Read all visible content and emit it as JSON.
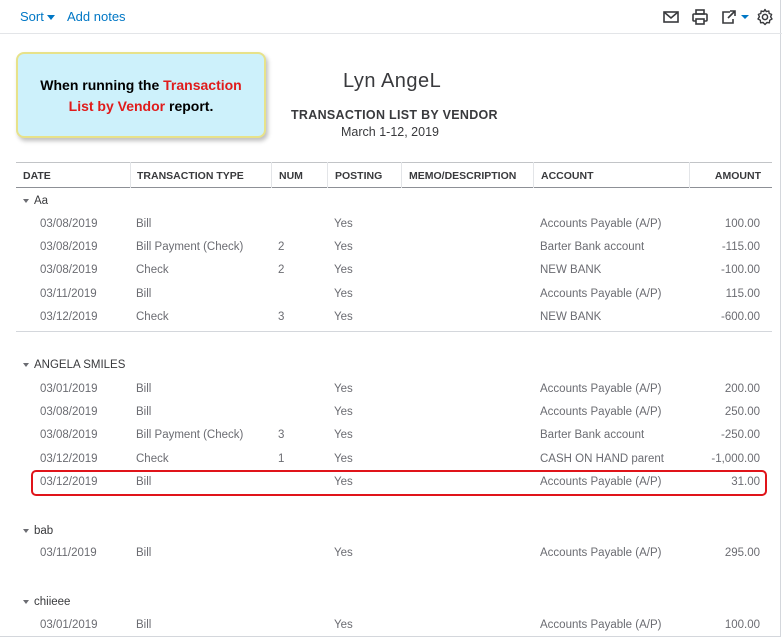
{
  "toolbar": {
    "sort_label": "Sort",
    "add_notes_label": "Add notes",
    "icons": [
      "email-icon",
      "print-icon",
      "export-icon",
      "settings-icon"
    ]
  },
  "callout": {
    "line1_plain": "When running the ",
    "line1_red": "Transaction",
    "line2_red": "List by Vendor",
    "line2_plain": " report."
  },
  "report": {
    "company": "Lyn AngeL",
    "title": "TRANSACTION LIST BY VENDOR",
    "date_range": "March 1-12, 2019"
  },
  "columns": [
    "DATE",
    "TRANSACTION TYPE",
    "NUM",
    "POSTING",
    "MEMO/DESCRIPTION",
    "ACCOUNT",
    "AMOUNT"
  ],
  "groups": [
    {
      "name": "Aa",
      "rows": [
        {
          "date": "03/08/2019",
          "type": "Bill",
          "num": "",
          "posting": "Yes",
          "memo": "",
          "account": "Accounts Payable (A/P)",
          "amount": "100.00"
        },
        {
          "date": "03/08/2019",
          "type": "Bill Payment (Check)",
          "num": "2",
          "posting": "Yes",
          "memo": "",
          "account": "Barter Bank account",
          "amount": "-115.00"
        },
        {
          "date": "03/08/2019",
          "type": "Check",
          "num": "2",
          "posting": "Yes",
          "memo": "",
          "account": "NEW BANK",
          "amount": "-100.00"
        },
        {
          "date": "03/11/2019",
          "type": "Bill",
          "num": "",
          "posting": "Yes",
          "memo": "",
          "account": "Accounts Payable (A/P)",
          "amount": "115.00"
        },
        {
          "date": "03/12/2019",
          "type": "Check",
          "num": "3",
          "posting": "Yes",
          "memo": "",
          "account": "NEW BANK",
          "amount": "-600.00"
        }
      ]
    },
    {
      "name": "ANGELA SMILES",
      "rows": [
        {
          "date": "03/01/2019",
          "type": "Bill",
          "num": "",
          "posting": "Yes",
          "memo": "",
          "account": "Accounts Payable (A/P)",
          "amount": "200.00"
        },
        {
          "date": "03/08/2019",
          "type": "Bill",
          "num": "",
          "posting": "Yes",
          "memo": "",
          "account": "Accounts Payable (A/P)",
          "amount": "250.00"
        },
        {
          "date": "03/08/2019",
          "type": "Bill Payment (Check)",
          "num": "3",
          "posting": "Yes",
          "memo": "",
          "account": "Barter Bank account",
          "amount": "-250.00"
        },
        {
          "date": "03/12/2019",
          "type": "Check",
          "num": "1",
          "posting": "Yes",
          "memo": "",
          "account": "CASH ON HAND parent",
          "amount": "-1,000.00"
        },
        {
          "date": "03/12/2019",
          "type": "Bill",
          "num": "",
          "posting": "Yes",
          "memo": "",
          "account": "Accounts Payable (A/P)",
          "amount": "31.00"
        }
      ]
    },
    {
      "name": "bab",
      "rows": [
        {
          "date": "03/11/2019",
          "type": "Bill",
          "num": "",
          "posting": "Yes",
          "memo": "",
          "account": "Accounts Payable (A/P)",
          "amount": "295.00"
        }
      ]
    },
    {
      "name": "chiieee",
      "rows": [
        {
          "date": "03/01/2019",
          "type": "Bill",
          "num": "",
          "posting": "Yes",
          "memo": "",
          "account": "Accounts Payable (A/P)",
          "amount": "100.00"
        }
      ]
    }
  ],
  "colors": {
    "link": "#0077c5",
    "highlight": "#e0141a",
    "callout_bg": "#cdf1fb",
    "callout_border": "#e7e28a"
  }
}
